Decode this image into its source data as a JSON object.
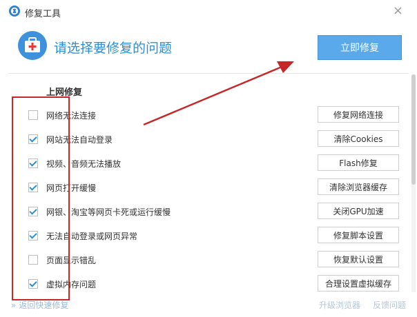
{
  "window": {
    "title": "修复工具"
  },
  "header": {
    "prompt": "请选择要修复的问题",
    "repair_now_label": "立即修复"
  },
  "section": {
    "title": "上网修复"
  },
  "items": [
    {
      "label": "网络无法连接",
      "checked": false,
      "button": "修复网络连接"
    },
    {
      "label": "网站无法自动登录",
      "checked": true,
      "button": "清除Cookies"
    },
    {
      "label": "视频、音频无法播放",
      "checked": true,
      "button": "Flash修复"
    },
    {
      "label": "网页打开缓慢",
      "checked": true,
      "button": "清除浏览器缓存"
    },
    {
      "label": "网银、淘宝等网页卡死或运行缓慢",
      "checked": true,
      "button": "关闭GPU加速"
    },
    {
      "label": "无法自动登录或网页异常",
      "checked": true,
      "button": "修复脚本设置"
    },
    {
      "label": "页面显示错乱",
      "checked": false,
      "button": "恢复默认设置"
    },
    {
      "label": "虚拟内存问题",
      "checked": true,
      "button": "合理设置虚拟缓存"
    }
  ],
  "footer": {
    "back_label": "返回快速修复",
    "upgrade_label": "升级浏览器",
    "feedback_label": "反馈问题"
  },
  "colors": {
    "accent": "#2c8fd6",
    "button_blue": "#5aa9ea",
    "annotation_red": "#c62828"
  }
}
